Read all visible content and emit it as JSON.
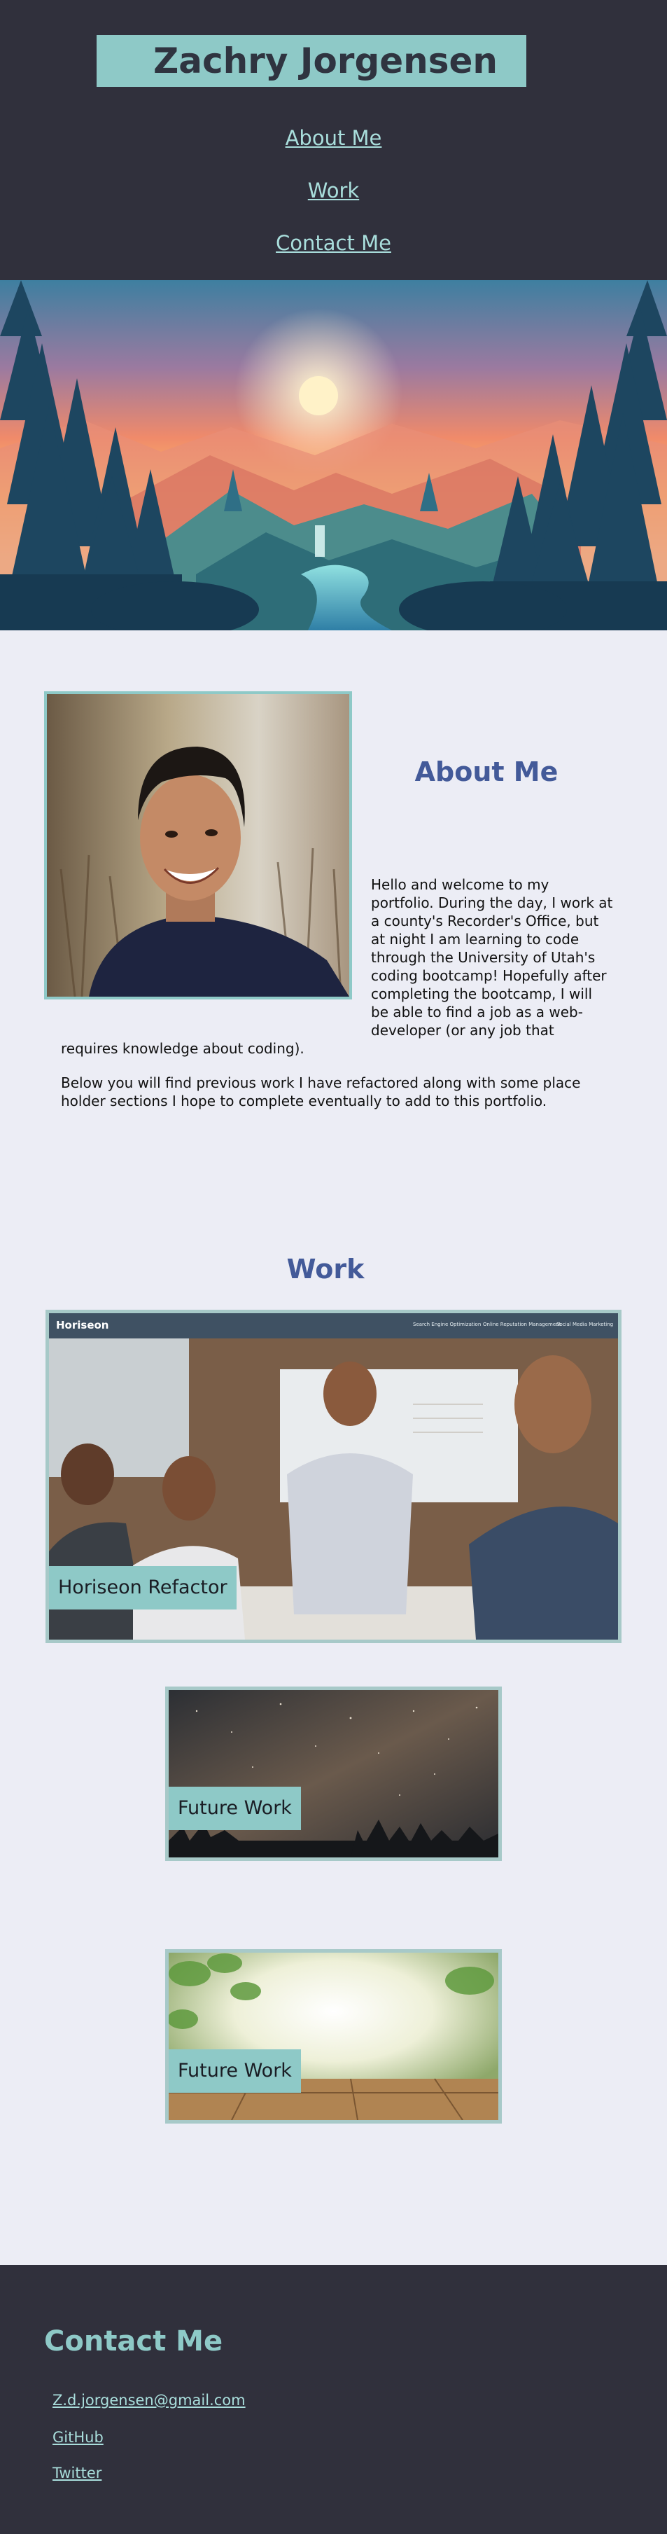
{
  "header": {
    "name": "Zachry Jorgensen",
    "nav": [
      "About Me",
      "Work",
      "Contact Me"
    ]
  },
  "about": {
    "title": "About Me",
    "paragraph1": "Hello and welcome to my portfolio. During the day, I work at a county's Recorder's Office, but at night I am learning to code through the University of Utah's coding bootcamp! Hopefully after completing the bootcamp, I will be able to find a job as a web-developer (or any job that requires knowledge about coding).",
    "paragraph2": "Below you will find previous work I have refactored along with some place holder sections I hope to complete eventually to add to this portfolio."
  },
  "work": {
    "title": "Work",
    "horiseon": {
      "label": "Horiseon Refactor",
      "site_name": "Horiseon",
      "site_nav": [
        "Search Engine Optimization",
        "Online Reputation Management",
        "Social Media Marketing"
      ]
    },
    "future1": "Future Work",
    "future2": "Future Work"
  },
  "contact": {
    "title": "Contact Me",
    "links": [
      "Z.d.jorgensen@gmail.com",
      "GitHub",
      "Twitter"
    ]
  },
  "colors": {
    "header_bg": "#30303c",
    "accent": "#8ec9c7",
    "title_blue": "#435a99",
    "page_bg": "#ecedf5"
  }
}
